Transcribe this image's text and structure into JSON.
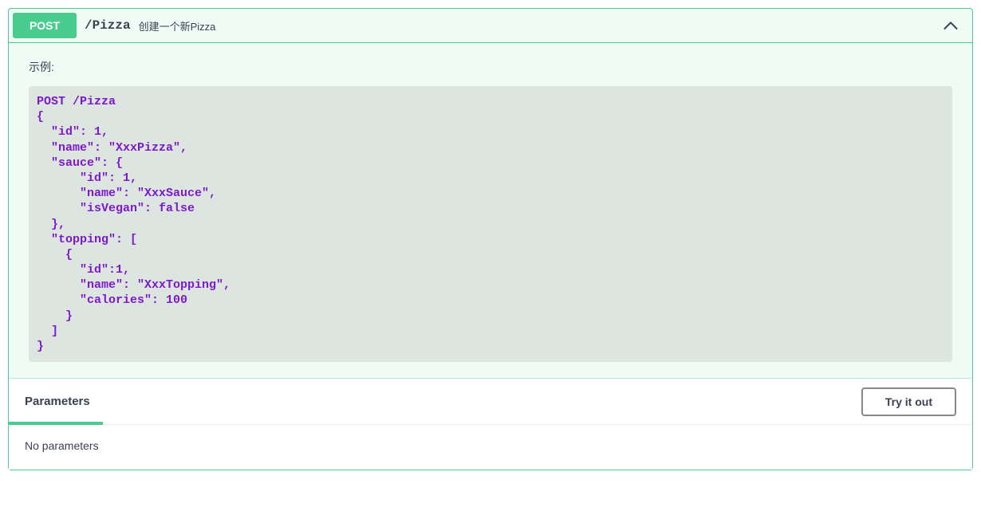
{
  "endpoint": {
    "method": "POST",
    "path": "/Pizza",
    "summary": "创建一个新Pizza"
  },
  "example": {
    "label": "示例:",
    "code": "POST /Pizza\n{\n  \"id\": 1,\n  \"name\": \"XxxPizza\",\n  \"sauce\": {\n      \"id\": 1,\n      \"name\": \"XxxSauce\",\n      \"isVegan\": false\n  },\n  \"topping\": [\n    {\n      \"id\":1,\n      \"name\": \"XxxTopping\",\n      \"calories\": 100\n    }\n  ]\n}"
  },
  "parameters": {
    "tab_label": "Parameters",
    "try_label": "Try it out",
    "empty_message": "No parameters"
  }
}
